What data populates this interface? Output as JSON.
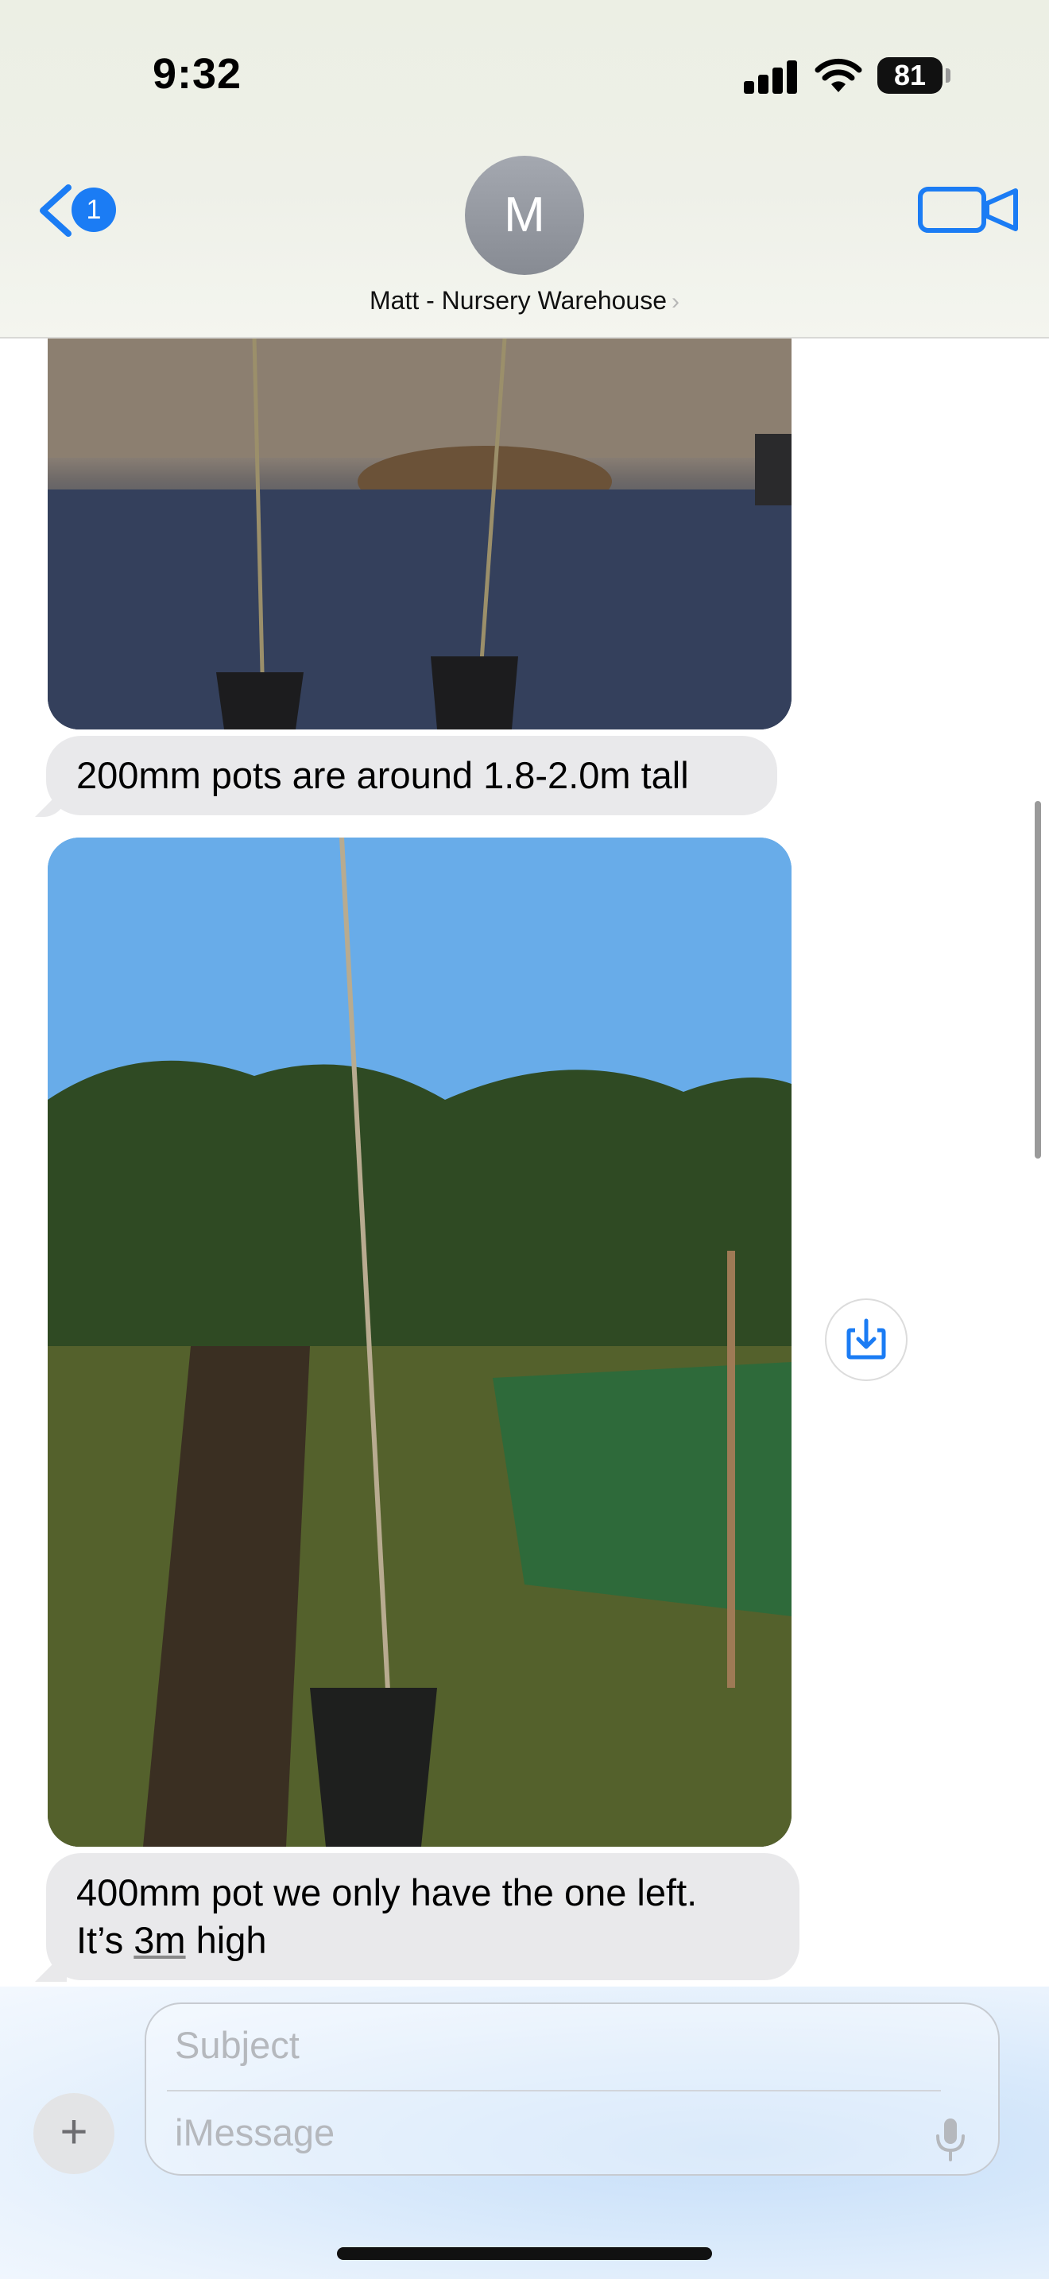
{
  "status_bar": {
    "time": "9:32",
    "battery": "81"
  },
  "header": {
    "back_badge_count": "1",
    "avatar_initial": "M",
    "contact_name": "Matt - Nursery Warehouse",
    "contact_chevron": "›"
  },
  "messages": [
    {
      "text": "200mm pots are around 1.8-2.0m tall"
    },
    {
      "text_line1": "400mm pot we only have the one left.",
      "text_line2_prefix": "It’s ",
      "text_line2_link": "3m",
      "text_line2_suffix": " high"
    }
  ],
  "compose": {
    "plus_label": "+",
    "subject_placeholder": "Subject",
    "message_placeholder": "iMessage"
  },
  "colors": {
    "accent": "#1b7cf4",
    "bubble": "#e9e9eb"
  },
  "icons": [
    "signal-icon",
    "wifi-icon",
    "battery-icon",
    "back-chevron-icon",
    "video-camera-icon",
    "save-download-icon",
    "microphone-icon",
    "plus-icon"
  ]
}
